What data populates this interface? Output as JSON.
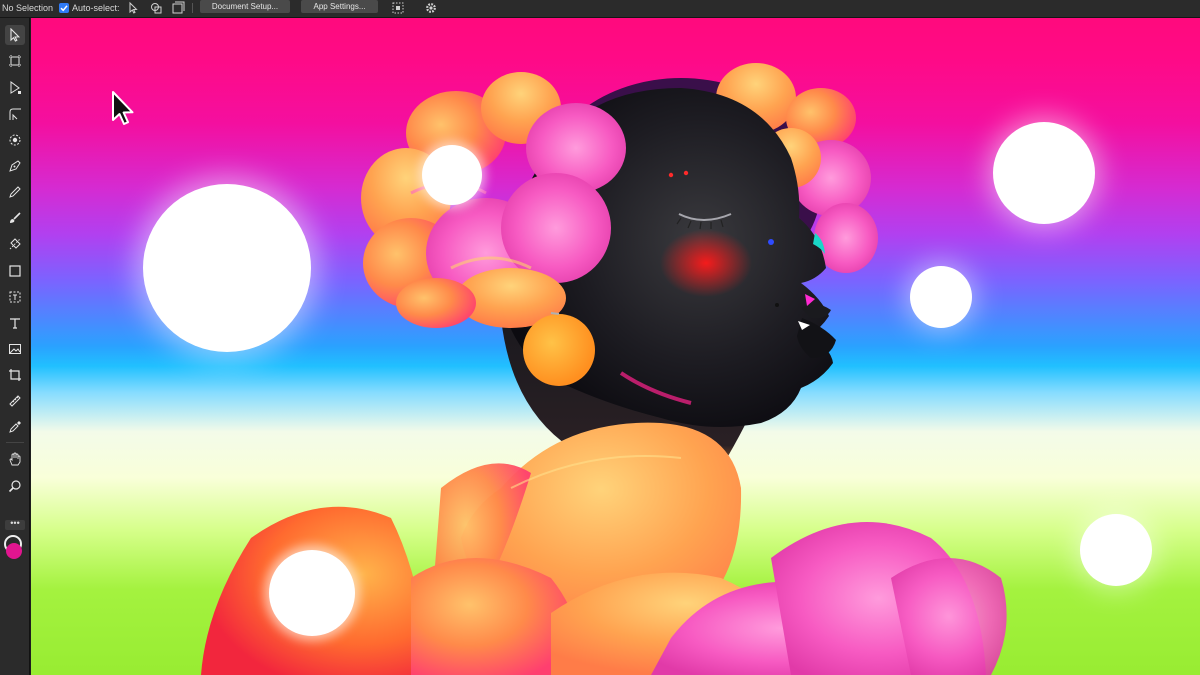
{
  "context_toolbar": {
    "selection_status": "No Selection",
    "auto_select_label": "Auto-select:",
    "auto_select_checked": true,
    "document_setup_label": "Document Setup...",
    "app_settings_label": "App Settings..."
  },
  "tools": [
    {
      "name": "move-tool",
      "icon": "arrow-pointer-icon"
    },
    {
      "name": "artboard-tool",
      "icon": "artboard-icon"
    },
    {
      "name": "node-tool",
      "icon": "node-arrow-icon"
    },
    {
      "name": "corner-tool",
      "icon": "corner-icon"
    },
    {
      "name": "point-transform-tool",
      "icon": "point-transform-icon"
    },
    {
      "name": "pen-tool",
      "icon": "pen-nib-icon"
    },
    {
      "name": "pencil-tool",
      "icon": "pencil-icon"
    },
    {
      "name": "vector-brush-tool",
      "icon": "brush-icon"
    },
    {
      "name": "fill-tool",
      "icon": "fill-icon"
    },
    {
      "name": "rectangle-tool",
      "icon": "square-icon"
    },
    {
      "name": "frame-text-tool",
      "icon": "frame-text-icon"
    },
    {
      "name": "artistic-text-tool",
      "icon": "text-icon"
    },
    {
      "name": "place-image-tool",
      "icon": "image-icon"
    },
    {
      "name": "crop-tool",
      "icon": "crop-icon"
    },
    {
      "name": "measure-tool",
      "icon": "ruler-icon"
    },
    {
      "name": "color-picker-tool",
      "icon": "eyedropper-icon"
    },
    {
      "name": "view-tool",
      "icon": "hand-icon"
    },
    {
      "name": "zoom-tool",
      "icon": "magnifier-icon"
    }
  ],
  "colors": {
    "accent": "#2f7bf6",
    "fill_swatch": "#e1158f",
    "stroke_swatch": "#eeeeee"
  }
}
